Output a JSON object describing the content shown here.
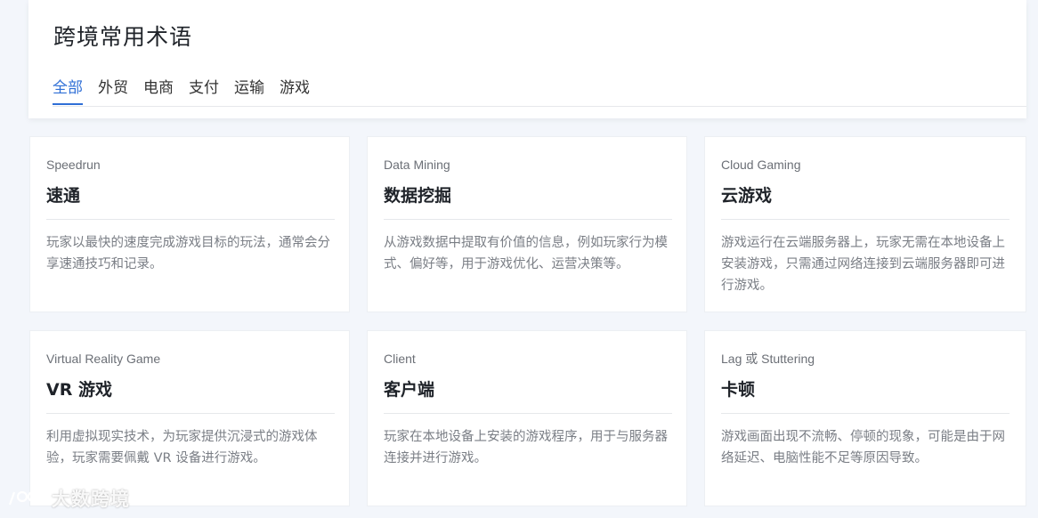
{
  "header": {
    "title": "跨境常用术语",
    "tabs": [
      {
        "label": "全部",
        "active": true
      },
      {
        "label": "外贸",
        "active": false
      },
      {
        "label": "电商",
        "active": false
      },
      {
        "label": "支付",
        "active": false
      },
      {
        "label": "运输",
        "active": false
      },
      {
        "label": "游戏",
        "active": false
      }
    ]
  },
  "cards": [
    {
      "en": "Speedrun",
      "zh": "速通",
      "desc": "玩家以最快的速度完成游戏目标的玩法，通常会分享速通技巧和记录。"
    },
    {
      "en": "Data Mining",
      "zh": "数据挖掘",
      "desc": "从游戏数据中提取有价值的信息，例如玩家行为模式、偏好等，用于游戏优化、运营决策等。"
    },
    {
      "en": "Cloud Gaming",
      "zh": "云游戏",
      "desc": "游戏运行在云端服务器上，玩家无需在本地设备上安装游戏，只需通过网络连接到云端服务器即可进行游戏。"
    },
    {
      "en": "Virtual Reality Game",
      "zh": "VR 游戏",
      "desc": "利用虚拟现实技术，为玩家提供沉浸式的游戏体验，玩家需要佩戴 VR 设备进行游戏。"
    },
    {
      "en": "Client",
      "zh": "客户端",
      "desc": "玩家在本地设备上安装的游戏程序，用于与服务器连接并进行游戏。"
    },
    {
      "en": "Lag 或 Stuttering",
      "zh": "卡顿",
      "desc": "游戏画面出现不流畅、停顿的现象，可能是由于网络延迟、电脑性能不足等原因导致。"
    }
  ],
  "watermark": {
    "text": "大数跨境"
  },
  "colors": {
    "accent": "#2f6fd6",
    "background": "#f3f6fb"
  }
}
